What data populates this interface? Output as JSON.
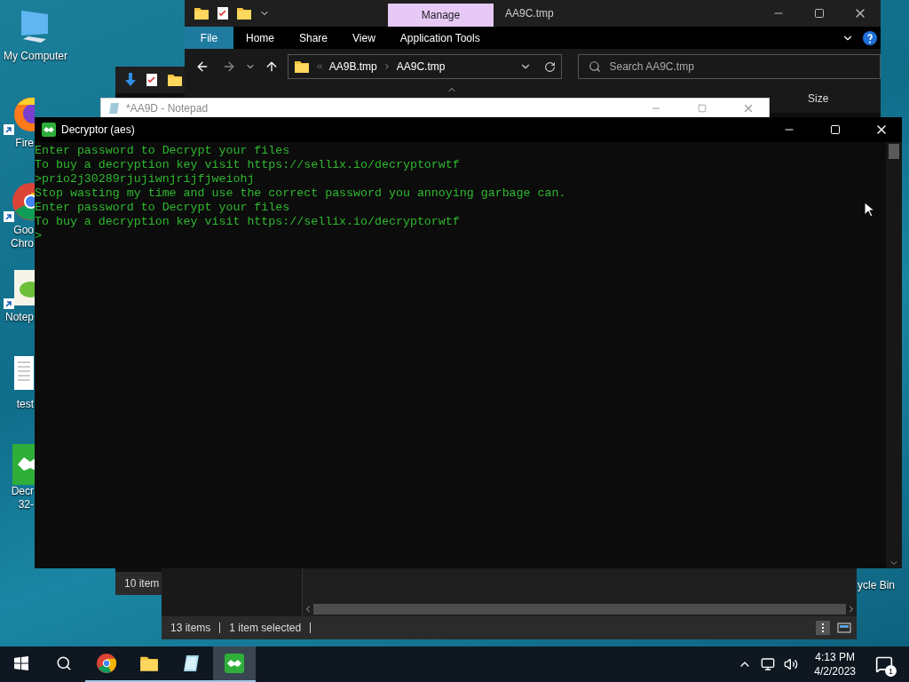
{
  "desktop": {
    "icons": [
      {
        "kind": "computer",
        "lines": [
          "My Computer"
        ],
        "shortcut": false
      },
      {
        "kind": "firefox",
        "lines": [
          "Fire"
        ],
        "shortcut": true
      },
      {
        "kind": "chrome",
        "lines": [
          "Goo",
          "Chro"
        ],
        "shortcut": true
      },
      {
        "kind": "notepadpp",
        "lines": [
          "Notep"
        ],
        "shortcut": true
      },
      {
        "kind": "textfile",
        "lines": [
          "test"
        ],
        "shortcut": false
      },
      {
        "kind": "decryptor",
        "lines": [
          "Decr",
          "32-"
        ],
        "shortcut": false
      }
    ],
    "recycle_bin": {
      "label": "ycle Bin"
    }
  },
  "explorer_back": {
    "status": "10 item"
  },
  "explorer_files": {
    "status": [
      "13 items",
      "1 item selected"
    ]
  },
  "explorer": {
    "context_tab": "Manage",
    "title": "AA9C.tmp",
    "ribbon_tabs": [
      {
        "label": "File",
        "selected": true
      },
      {
        "label": "Home",
        "selected": false
      },
      {
        "label": "Share",
        "selected": false
      },
      {
        "label": "View",
        "selected": false
      },
      {
        "label": "Application Tools",
        "selected": false
      }
    ],
    "path": [
      "AA9B.tmp",
      "AA9C.tmp"
    ],
    "search": {
      "placeholder": "Search AA9C.tmp"
    },
    "columns": [
      "Size"
    ]
  },
  "notepad": {
    "title": "*AA9D - Notepad"
  },
  "console": {
    "title": "Decryptor (aes)",
    "lines": [
      "Enter password to Decrypt your files",
      "To buy a decryption key visit https://sellix.io/decryptorwtf",
      ">prio2j30289rjujiwnjrijfjweiohj",
      "Stop wasting my time and use the correct password you annoying garbage can.",
      "Enter password to Decrypt your files",
      "To buy a decryption key visit https://sellix.io/decryptorwtf"
    ],
    "prompt": ">"
  },
  "taskbar": {
    "apps": [
      {
        "kind": "chrome",
        "running": true,
        "selected": false
      },
      {
        "kind": "folder",
        "running": true,
        "selected": false
      },
      {
        "kind": "notepad",
        "running": true,
        "selected": false
      },
      {
        "kind": "decryptor",
        "running": true,
        "selected": true
      }
    ],
    "clock": {
      "time": "4:13 PM",
      "date": "4/2/2023"
    },
    "notifications": "1"
  }
}
